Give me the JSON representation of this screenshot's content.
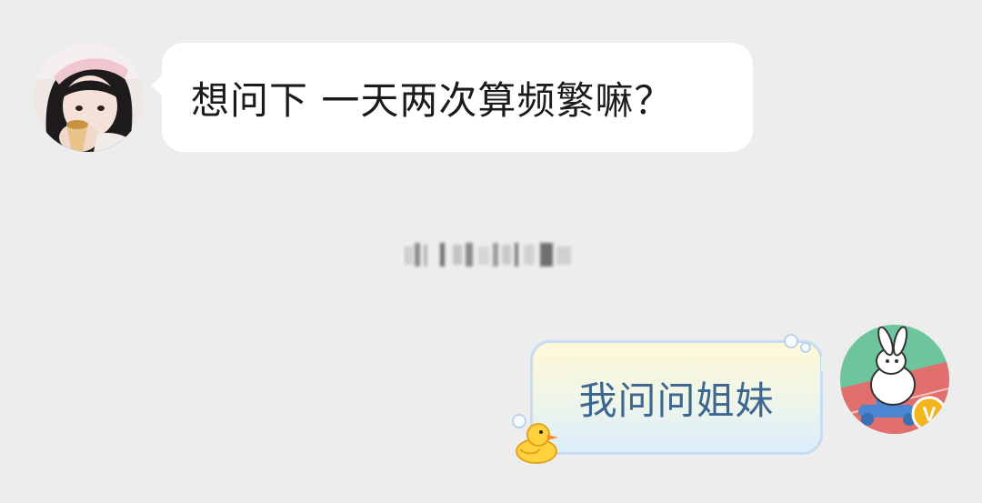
{
  "conversation": {
    "incoming": {
      "text": "想问下 一天两次算频繁嘛？",
      "avatar_icon": "girl-avatar-icon"
    },
    "system_notice": {
      "text": "",
      "note_style": "blurred"
    },
    "outgoing": {
      "text": "我问问姐妹",
      "avatar_icon": "bunny-scooter-avatar-icon",
      "badge_icon": "vip-v-badge-icon",
      "bubble_deco_icon": "duck-icon"
    }
  },
  "colors": {
    "background": "#ededed",
    "incoming_bubble": "#ffffff",
    "outgoing_text": "#3d6790",
    "outgoing_border": "#c7dcf2",
    "badge": "#f3b51d"
  }
}
